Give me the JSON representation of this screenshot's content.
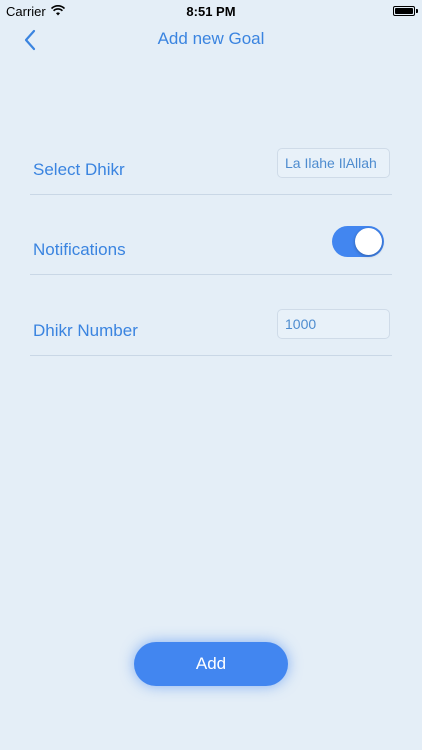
{
  "status_bar": {
    "carrier": "Carrier",
    "time": "8:51 PM"
  },
  "nav": {
    "title": "Add new Goal",
    "back_icon": "chevron-left-icon"
  },
  "form": {
    "select_dhikr": {
      "label": "Select Dhikr",
      "value": "La Ilahe IlAllah"
    },
    "notifications": {
      "label": "Notifications",
      "enabled": true
    },
    "dhikr_number": {
      "label": "Dhikr Number",
      "value": "1000"
    }
  },
  "add_button": {
    "label": "Add"
  },
  "colors": {
    "background": "#e4eef7",
    "accent": "#3a84e0",
    "button": "#4286f0"
  }
}
